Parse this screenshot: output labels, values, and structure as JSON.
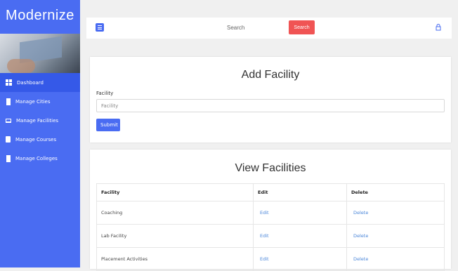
{
  "brand": {
    "name": "Modernize"
  },
  "sidebar": {
    "items": [
      {
        "label": "Dashboard",
        "icon": "dashboard-grid-icon",
        "active": true
      },
      {
        "label": "Manage Cities",
        "icon": "building-icon",
        "active": false
      },
      {
        "label": "Manage Facilities",
        "icon": "laptop-icon",
        "active": false
      },
      {
        "label": "Manage Courses",
        "icon": "document-icon",
        "active": false
      },
      {
        "label": "Manage Colleges",
        "icon": "building-icon",
        "active": false
      }
    ]
  },
  "header": {
    "search_placeholder": "Search",
    "search_button": "Search",
    "user_icon": "user-lock-icon"
  },
  "add_facility": {
    "title": "Add Facility",
    "field_label": "Facility",
    "field_placeholder": "Facility",
    "submit_label": "Submit"
  },
  "view_facilities": {
    "title": "View Facilities",
    "columns": [
      "Facility",
      "Edit",
      "Delete"
    ],
    "rows": [
      {
        "facility": "Coaching",
        "edit": "Edit",
        "delete": "Delete"
      },
      {
        "facility": "Lab Facility",
        "edit": "Edit",
        "delete": "Delete"
      },
      {
        "facility": "Placement Activities",
        "edit": "Edit",
        "delete": "Delete"
      }
    ]
  },
  "colors": {
    "sidebar": "#4a6cf2",
    "sidebar_active": "#3559e8",
    "search_button": "#f05454",
    "link": "#4a86d9",
    "submit": "#4a6cf2"
  }
}
